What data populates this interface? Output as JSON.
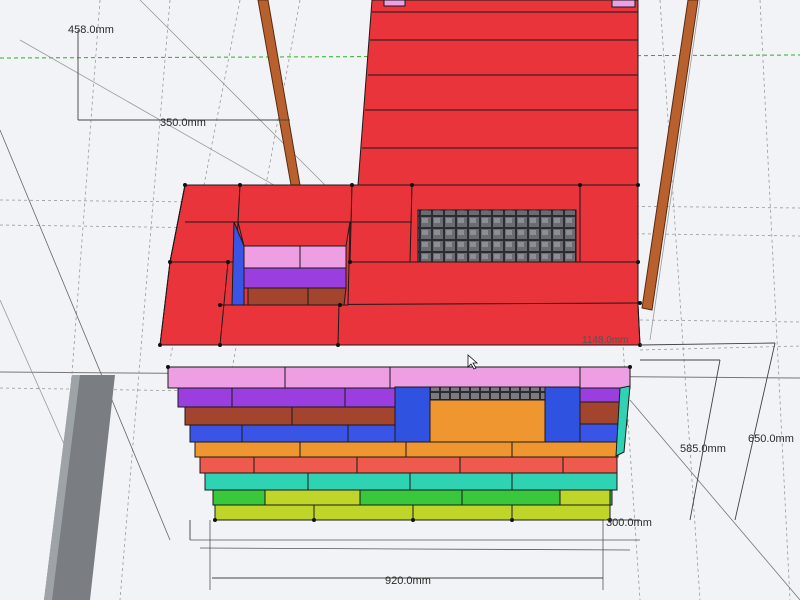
{
  "app": {
    "view": "3D model viewport"
  },
  "dimensions": {
    "top_left_width": "458.0mm",
    "top_left_depth": "350.0mm",
    "total_height_label": "1148.0mm",
    "right_height_1": "585.0mm",
    "right_height_2": "650.0mm",
    "bottom_depth": "300.0mm",
    "bottom_width": "920.0mm"
  },
  "colors": {
    "background": "#f2f3f6",
    "brick_red": "#e8343a",
    "brick_pink": "#ee9fe4",
    "brick_purple": "#9b3ee0",
    "brick_brown": "#a3452e",
    "brick_blue": "#3a55e6",
    "brick_orange": "#f09630",
    "brick_salmon": "#ee5a4d",
    "brick_teal": "#2fd3b3",
    "brick_green": "#39c83c",
    "brick_yellow": "#bfd52a",
    "post_brown": "#b8612f",
    "grate": "#58585f",
    "axis_green": "#28b028"
  },
  "icons": [
    "mouse-pointer-icon"
  ]
}
